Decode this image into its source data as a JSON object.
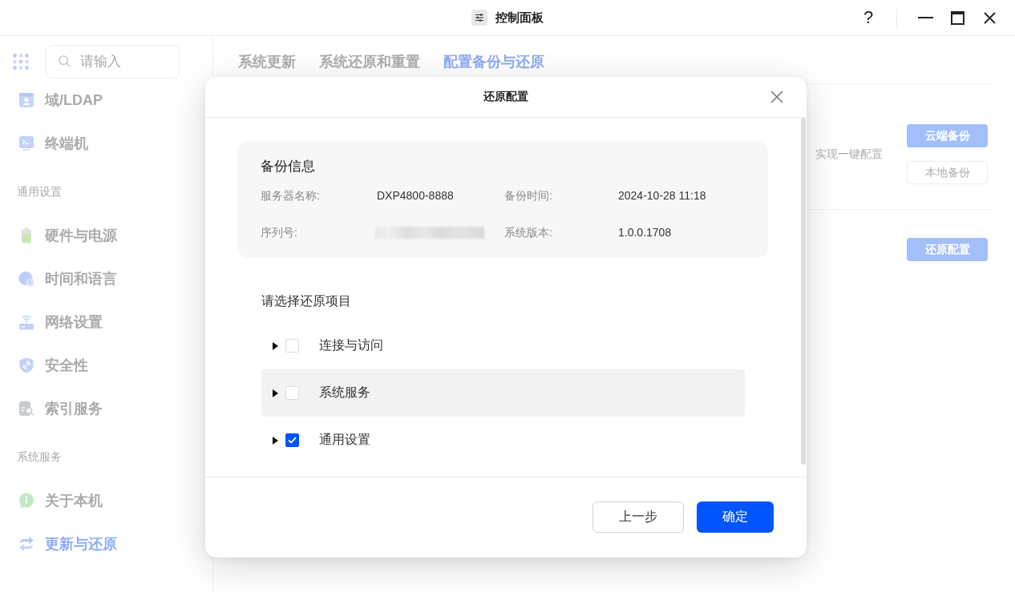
{
  "window": {
    "title": "控制面板",
    "help": "?"
  },
  "sidebar": {
    "search": {
      "placeholder": "请输入"
    },
    "items": [
      {
        "kind": "item",
        "label": "域/LDAP",
        "selected": false
      },
      {
        "kind": "item",
        "label": "终端机",
        "selected": false
      },
      {
        "kind": "section",
        "label": "通用设置"
      },
      {
        "kind": "item",
        "label": "硬件与电源",
        "selected": false
      },
      {
        "kind": "item",
        "label": "时间和语言",
        "selected": false
      },
      {
        "kind": "item",
        "label": "网络设置",
        "selected": false
      },
      {
        "kind": "item",
        "label": "安全性",
        "selected": false
      },
      {
        "kind": "item",
        "label": "索引服务",
        "selected": false
      },
      {
        "kind": "section",
        "label": "系统服务"
      },
      {
        "kind": "item",
        "label": "关于本机",
        "selected": false
      },
      {
        "kind": "item",
        "label": "更新与还原",
        "selected": true
      }
    ]
  },
  "tabs": [
    {
      "label": "系统更新",
      "selected": false
    },
    {
      "label": "系统还原和重置",
      "selected": false
    },
    {
      "label": "配置备份与还原",
      "selected": true
    }
  ],
  "panels": [
    {
      "description": "实现一键配置",
      "buttons": [
        {
          "label": "云端备份",
          "kind": "primary"
        },
        {
          "label": "本地备份",
          "kind": "secondary"
        }
      ]
    },
    {
      "buttons": [
        {
          "label": "还原配置",
          "kind": "primary"
        }
      ]
    }
  ],
  "dialog": {
    "title": "还原配置",
    "info": {
      "title": "备份信息",
      "fields": [
        {
          "label": "服务器名称:",
          "value": "DXP4800-8888"
        },
        {
          "label": "备份时间:",
          "value": "2024-10-28 11:18"
        },
        {
          "label": "序列号:",
          "redacted": true
        },
        {
          "label": "系统版本:",
          "value": "1.0.0.1708"
        }
      ]
    },
    "items_heading": "请选择还原项目",
    "items": [
      {
        "label": "连接与访问",
        "checked": false,
        "expanded": false,
        "hovered": false
      },
      {
        "label": "系统服务",
        "checked": false,
        "expanded": false,
        "hovered": true
      },
      {
        "label": "通用设置",
        "checked": true,
        "expanded": false,
        "hovered": false
      }
    ],
    "buttons": [
      {
        "label": "上一步",
        "kind": "secondary"
      },
      {
        "label": "确定",
        "kind": "primary"
      }
    ]
  }
}
